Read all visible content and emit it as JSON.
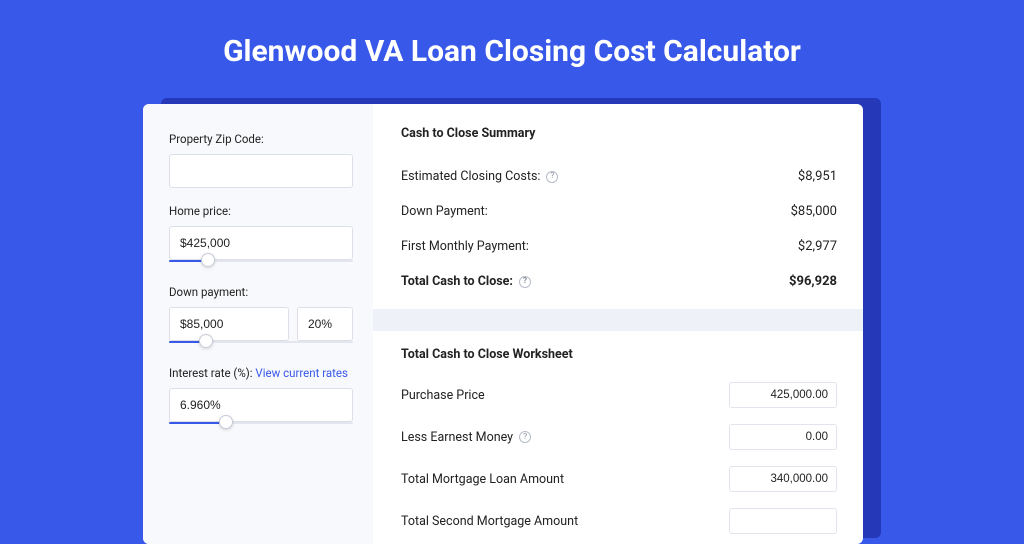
{
  "page_title": "Glenwood VA Loan Closing Cost Calculator",
  "left": {
    "zip_label": "Property Zip Code:",
    "zip_value": "",
    "home_price_label": "Home price:",
    "home_price_value": "$425,000",
    "home_price_slider_pct": 21,
    "down_payment_label": "Down payment:",
    "down_payment_value": "$85,000",
    "down_payment_pct": "20%",
    "down_payment_slider_pct": 20,
    "rate_label": "Interest rate (%): ",
    "rate_link": "View current rates",
    "rate_value": "6.960%",
    "rate_slider_pct": 31
  },
  "summary": {
    "heading": "Cash to Close Summary",
    "rows": [
      {
        "label": "Estimated Closing Costs:",
        "help": true,
        "value": "$8,951"
      },
      {
        "label": "Down Payment:",
        "help": false,
        "value": "$85,000"
      },
      {
        "label": "First Monthly Payment:",
        "help": false,
        "value": "$2,977"
      }
    ],
    "total": {
      "label": "Total Cash to Close:",
      "help": true,
      "value": "$96,928"
    }
  },
  "worksheet": {
    "heading": "Total Cash to Close Worksheet",
    "rows": [
      {
        "label": "Purchase Price",
        "help": false,
        "value": "425,000.00"
      },
      {
        "label": "Less Earnest Money",
        "help": true,
        "value": "0.00"
      },
      {
        "label": "Total Mortgage Loan Amount",
        "help": false,
        "value": "340,000.00"
      },
      {
        "label": "Total Second Mortgage Amount",
        "help": false,
        "value": ""
      }
    ]
  }
}
